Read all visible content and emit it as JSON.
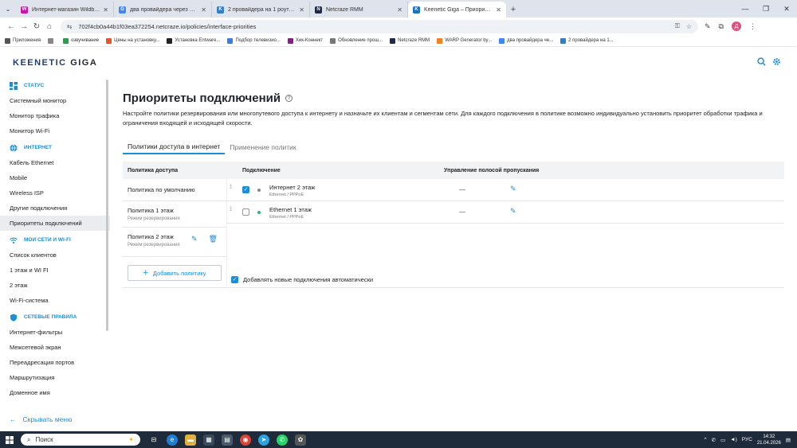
{
  "browser": {
    "tabs": [
      {
        "title": "Интернет-магазин Wildberries",
        "color": "#cb11ab",
        "glyph": "W"
      },
      {
        "title": "два провайдера через один р...",
        "color": "#4285f4",
        "glyph": "G"
      },
      {
        "title": "2 провайдера на 1 роутере - ...",
        "color": "#2f7fc8",
        "glyph": "K"
      },
      {
        "title": "Netcraze RMM",
        "color": "#1e2a4a",
        "glyph": "N"
      },
      {
        "title": "Keenetic Giga – Приоритеты п...",
        "color": "#1a6fc6",
        "glyph": "K"
      }
    ],
    "active_tab": 4,
    "new_tab_label": "+",
    "url": "702f4cb0a44b1f03ea372254.netcraze.io/policies/interface-priorities",
    "profile_initial": "Д",
    "bookmarks": [
      {
        "label": "Приложения",
        "color": "#555"
      },
      {
        "label": "",
        "color": "#888"
      },
      {
        "label": "озвучивание",
        "color": "#2e9c4a"
      },
      {
        "label": "Цены на установку...",
        "color": "#e4572e"
      },
      {
        "label": "Установка Entware...",
        "color": "#222"
      },
      {
        "label": "Подбор телевизио...",
        "color": "#3b7dd8"
      },
      {
        "label": "Хик-Коннект",
        "color": "#8a1c8a"
      },
      {
        "label": "Обновление прош...",
        "color": "#777"
      },
      {
        "label": "Netcraze RMM",
        "color": "#1e2a4a"
      },
      {
        "label": "WARP Generator by...",
        "color": "#f48120"
      },
      {
        "label": "два провайдера че...",
        "color": "#4285f4"
      },
      {
        "label": "2 провайдера на 1...",
        "color": "#2f7fc8"
      }
    ]
  },
  "app": {
    "logo_main": "KEENETIC",
    "logo_sub": "GIGA"
  },
  "sidebar": {
    "sections": [
      {
        "label": "СТАТУС",
        "icon": "dashboard-icon",
        "items": [
          "Системный монитор",
          "Монитор трафика",
          "Монитор Wi-Fi"
        ]
      },
      {
        "label": "ИНТЕРНЕТ",
        "icon": "globe-icon",
        "items": [
          "Кабель Ethernet",
          "Mobile",
          "Wireless ISP",
          "Другие подключения",
          "Приоритеты подключений"
        ]
      },
      {
        "label": "МОИ СЕТИ И WI-FI",
        "icon": "wifi-icon",
        "items": [
          "Список клиентов",
          "1 этаж и WI FI",
          "2 этаж",
          "Wi-Fi-система"
        ]
      },
      {
        "label": "СЕТЕВЫЕ ПРАВИЛА",
        "icon": "shield-icon",
        "items": [
          "Интернет-фильтры",
          "Межсетевой экран",
          "Переадресация портов",
          "Маршрутизация",
          "Доменное имя"
        ]
      }
    ],
    "active_item": "Приоритеты подключений",
    "hide_menu": "Скрывать меню"
  },
  "main": {
    "title": "Приоритеты подключений",
    "description": "Настройте политики резервирования или многопутевого доступа к интернету и назначьте их клиентам и сегментам сети. Для каждого подключения в политике возможно индивидуально установить приоритет обработки трафика и ограничения входящей и исходящей скорости.",
    "tabs": [
      "Политики доступа в интернет",
      "Применение политик"
    ],
    "active_tab": 0,
    "headers": {
      "policy": "Политика доступа",
      "connection": "Подключение",
      "bandwidth": "Управление полосой пропускания"
    },
    "policies": [
      {
        "name": "Политика по умолчанию",
        "sub": ""
      },
      {
        "name": "Политика 1 этаж",
        "sub": "Режим резервирования"
      },
      {
        "name": "Политика 2 этаж",
        "sub": "Режим резервирования"
      }
    ],
    "selected_policy": 2,
    "add_policy": "Добавить политику",
    "connections": [
      {
        "name": "Интернет 2 этаж",
        "sub": "Ethernet / PPPoE",
        "checked": true,
        "status_color": "#888888",
        "bandwidth": "—"
      },
      {
        "name": "Ethernet 1 этаж",
        "sub": "Ethernet / PPPoE",
        "checked": false,
        "status_color": "#2eb872",
        "bandwidth": "—"
      }
    ],
    "auto_add": {
      "label": "Добавлять новые подключения автоматически",
      "checked": true
    }
  },
  "taskbar": {
    "search_placeholder": "Поиск",
    "lang": "РУС",
    "time": "14:32",
    "date": "21.04.2026"
  }
}
